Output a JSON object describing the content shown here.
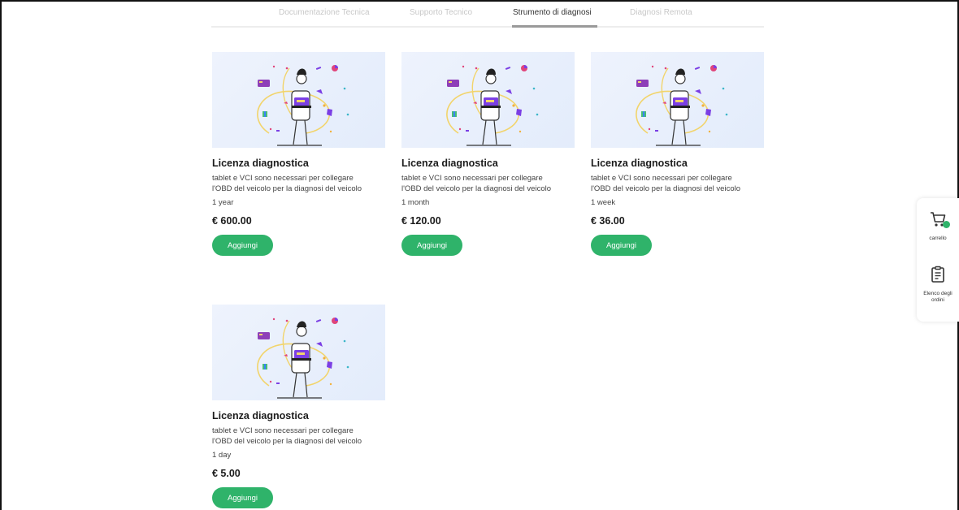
{
  "tabs": [
    {
      "label": "Documentazione Tecnica",
      "active": false
    },
    {
      "label": "Supporto Tecnico",
      "active": false
    },
    {
      "label": "Strumento di diagnosi",
      "active": true
    },
    {
      "label": "Diagnosi Remota",
      "active": false
    }
  ],
  "products": [
    {
      "title": "Licenza diagnostica",
      "desc_line1": "tablet e VCI sono necessari per collegare",
      "desc_line2": "l'OBD del veicolo per la diagnosi del veicolo",
      "duration": "1 year",
      "price": "€ 600.00",
      "button": "Aggiungi"
    },
    {
      "title": "Licenza diagnostica",
      "desc_line1": "tablet e VCI sono necessari per collegare",
      "desc_line2": "l'OBD del veicolo per la diagnosi del veicolo",
      "duration": "1 month",
      "price": "€ 120.00",
      "button": "Aggiungi"
    },
    {
      "title": "Licenza diagnostica",
      "desc_line1": "tablet e VCI sono necessari per collegare",
      "desc_line2": "l'OBD del veicolo per la diagnosi del veicolo",
      "duration": "1 week",
      "price": "€ 36.00",
      "button": "Aggiungi"
    },
    {
      "title": "Licenza diagnostica",
      "desc_line1": "tablet e VCI sono necessari per collegare",
      "desc_line2": "l'OBD del veicolo per la diagnosi del veicolo",
      "duration": "1 day",
      "price": "€ 5.00",
      "button": "Aggiungi"
    }
  ],
  "side": {
    "cart_label": "carrello",
    "orders_label_line1": "Elenco degli",
    "orders_label_line2": "ordini"
  },
  "colors": {
    "accent": "#2fb36a",
    "thumb_bg": "#e8f0fc"
  }
}
